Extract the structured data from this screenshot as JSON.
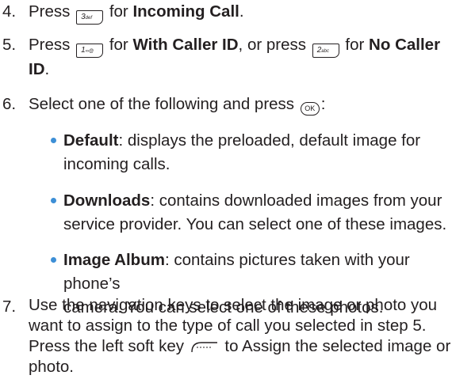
{
  "steps": {
    "s4": {
      "number": "4.",
      "press": "Press",
      "key_label": "3",
      "key_sub": "def",
      "for": "for",
      "bold": "Incoming Call",
      "end": "."
    },
    "s5": {
      "number": "5.",
      "press": "Press",
      "key1_label": "1",
      "key1_sub": "∞@",
      "for1": "for",
      "bold1": "With Caller ID",
      "mid": ", or press",
      "key2_label": "2",
      "key2_sub": "abc",
      "for2": "for",
      "bold2_line1": "No Caller",
      "bold2_line2": "ID",
      "end": "."
    },
    "s6": {
      "number": "6.",
      "text": "Select one of the following and press",
      "ok_label": "OK",
      "end": ":"
    },
    "s7": {
      "number": "7.",
      "line1": "Use the navigation keys to select the image or photo you",
      "line2": "want to assign to the type of call you selected in step 5.",
      "line3_pre": "Press the left soft key",
      "line3_post": "to Assign the selected image or",
      "line4": "photo."
    }
  },
  "options": [
    {
      "title": "Default",
      "line1": ": displays the preloaded, default image for",
      "line2": "incoming calls."
    },
    {
      "title": "Downloads",
      "line1": ": contains downloaded images from your",
      "line2": "service provider. You can select one of these images."
    },
    {
      "title": "Image Album",
      "line1": ": contains pictures taken with your phone’s",
      "line2": "camera. You can select one of these photos."
    }
  ],
  "colors": {
    "text": "#231f20",
    "bullet": "#3d8fd6"
  },
  "icons": {
    "keypad": "keypad-key-icon",
    "ok": "ok-key-icon",
    "soft": "left-soft-key-icon"
  }
}
